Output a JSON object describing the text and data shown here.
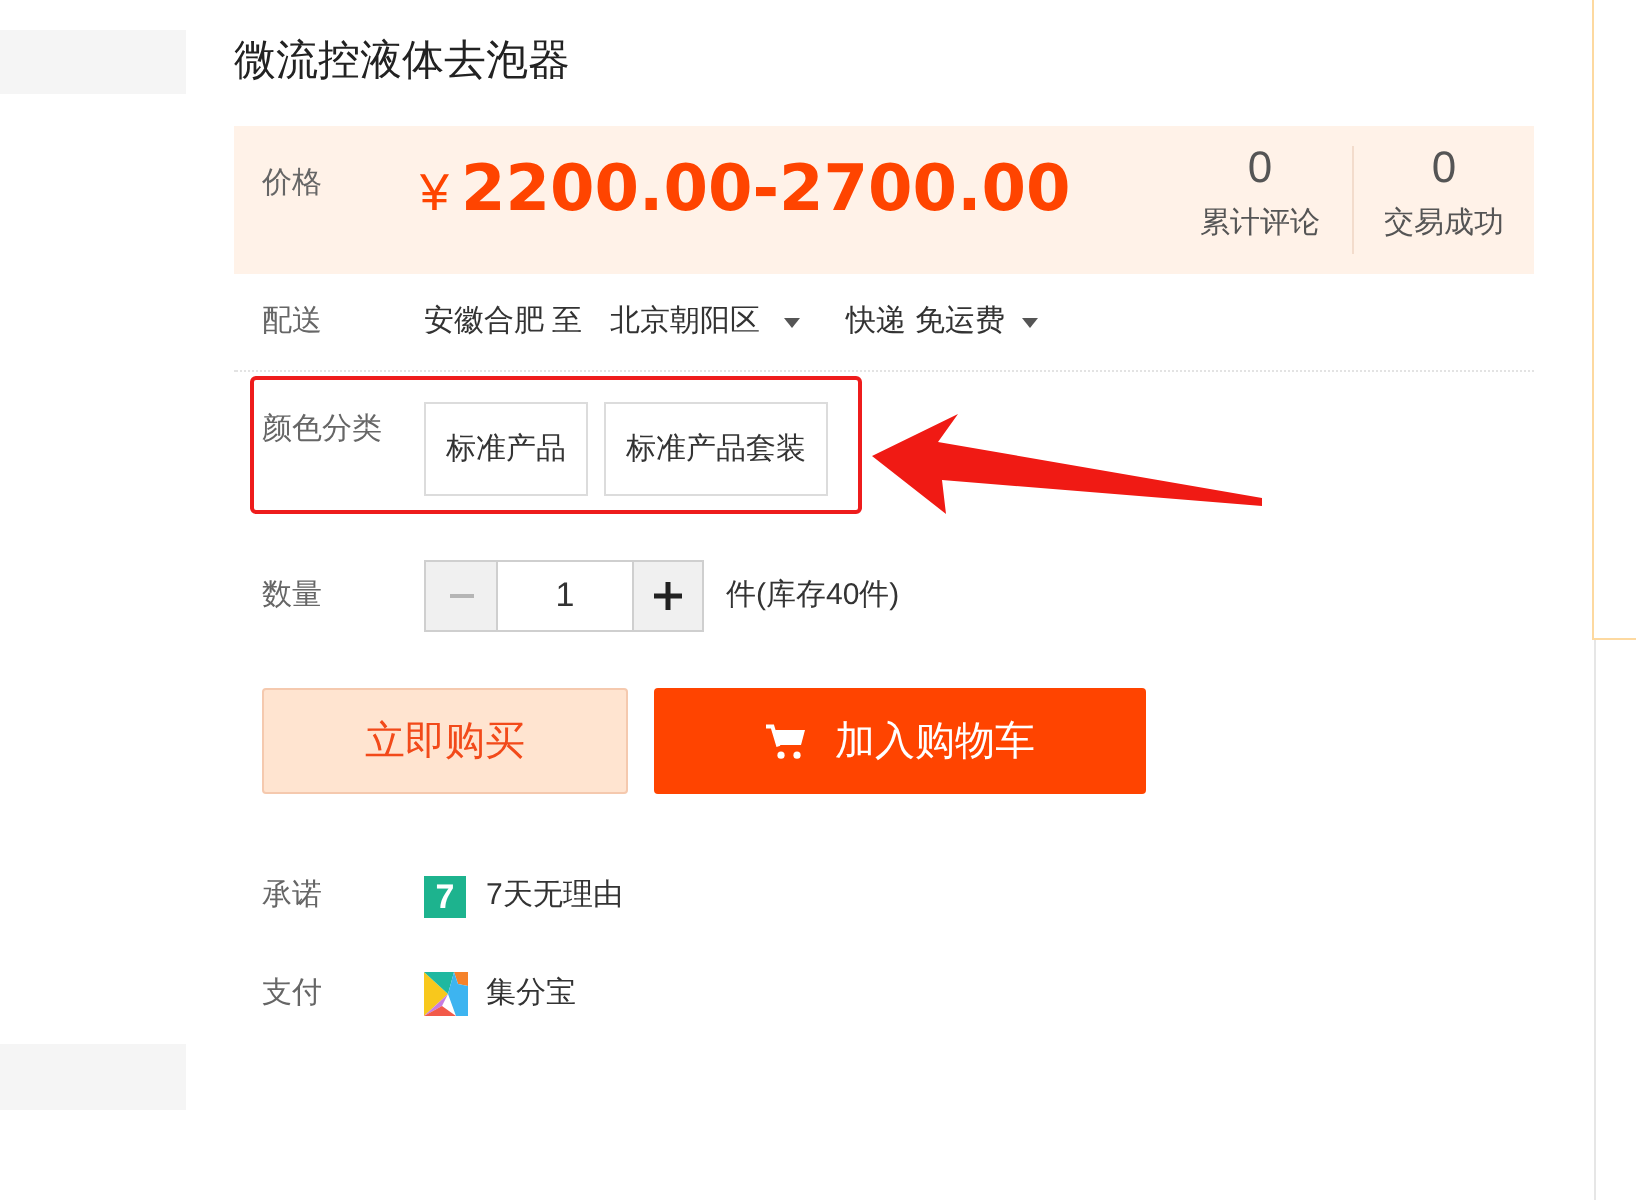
{
  "title": "微流控液体去泡器",
  "price": {
    "label": "价格",
    "currency": "¥",
    "amount": "2200.00-2700.00",
    "stats": [
      {
        "count": "0",
        "label": "累计评论"
      },
      {
        "count": "0",
        "label": "交易成功"
      }
    ]
  },
  "delivery": {
    "label": "配送",
    "origin": "安徽合肥 至",
    "destination": "北京朝阳区",
    "shipping": "快递 免运费"
  },
  "variants": {
    "label": "颜色分类",
    "highlighted": true,
    "options": [
      {
        "label": "标准产品",
        "selected": false
      },
      {
        "label": "标准产品套装",
        "selected": false
      }
    ]
  },
  "quantity": {
    "label": "数量",
    "value": "1",
    "decrease_disabled": true,
    "increase_disabled": false,
    "stock": "件(库存40件)"
  },
  "actions": [
    {
      "kind": "buy",
      "label": "立即购买"
    },
    {
      "kind": "cart",
      "label": "加入购物车"
    }
  ],
  "services": [
    {
      "kind": "promise",
      "label": "承诺",
      "badge": "7",
      "text": "7天无理由"
    },
    {
      "kind": "payment",
      "label": "支付",
      "text": "集分宝"
    }
  ]
}
